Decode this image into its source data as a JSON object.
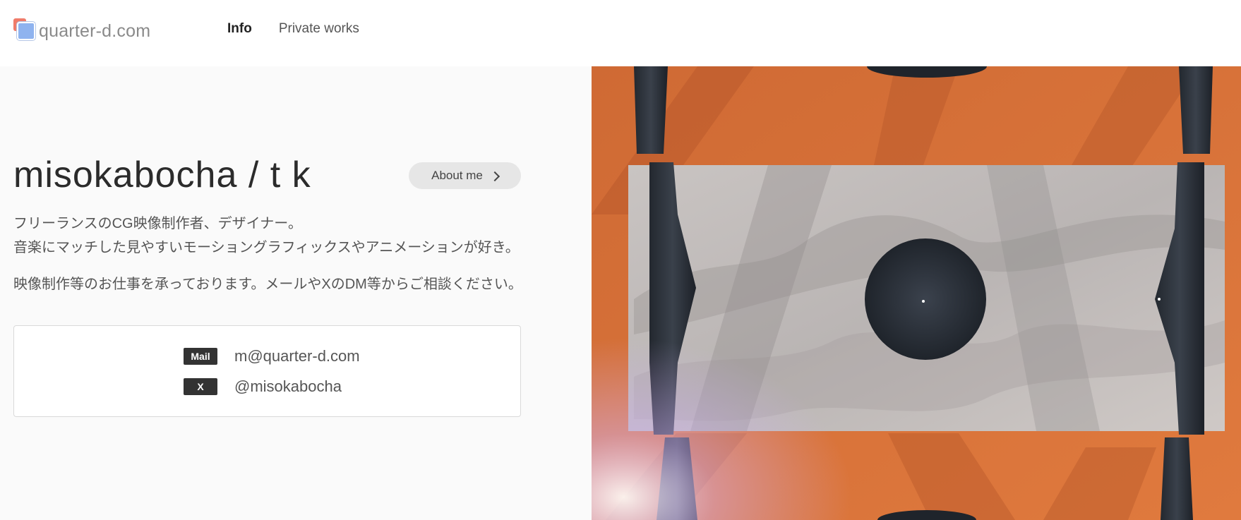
{
  "header": {
    "logo_text": "quarter-d.com",
    "nav": [
      {
        "label": "Info",
        "active": true
      },
      {
        "label": "Private works",
        "active": false
      }
    ]
  },
  "main": {
    "title": "misokabocha / t k",
    "about_button": "About me",
    "description_lines": [
      "フリーランスのCG映像制作者、デザイナー。",
      "音楽にマッチした見やすいモーショングラフィックスやアニメーションが好き。"
    ],
    "description_2": "映像制作等のお仕事を承っております。メールやXのDM等からご相談ください。",
    "contacts": [
      {
        "badge": "Mail",
        "value": "m@quarter-d.com"
      },
      {
        "badge": "X",
        "value": "@misokabocha"
      }
    ]
  },
  "colors": {
    "accent_orange": "#d7733c",
    "badge_bg": "#333333"
  }
}
